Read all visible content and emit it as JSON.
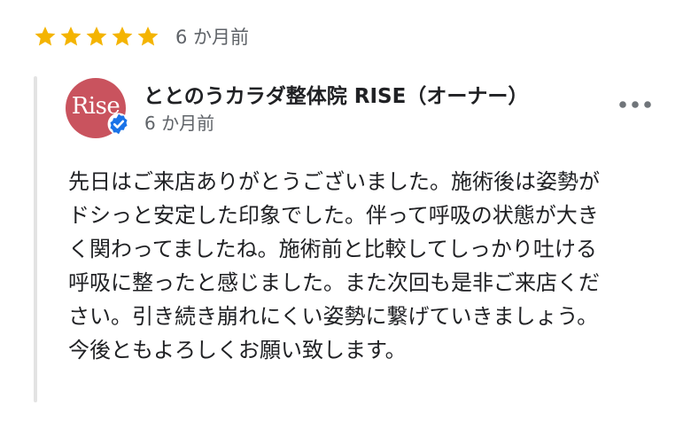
{
  "review": {
    "rating": 5,
    "star_color": "#F4B400",
    "time": "6 か月前"
  },
  "owner_reply": {
    "avatar": {
      "text": "Rise",
      "color": "#C9535E"
    },
    "verified_icon": "verified-check-icon",
    "verified_color": "#1A73E8",
    "name": "ととのうカラダ整体院 RISE（オーナー）",
    "time": "6 か月前",
    "more_icon": "more-horizontal-icon",
    "lines": [
      "先日はご来店ありがとうございました。施術後は姿勢が",
      "ドシっと安定した印象でした。伴って呼吸の状態が大き",
      "く関わってましたね。施術前と比較してしっかり吐ける",
      "呼吸に整ったと感じました。また次回も是非ご来店くだ",
      "さい。引き続き崩れにくい姿勢に繋げていきましょう。",
      "今後ともよろしくお願い致します。"
    ]
  }
}
